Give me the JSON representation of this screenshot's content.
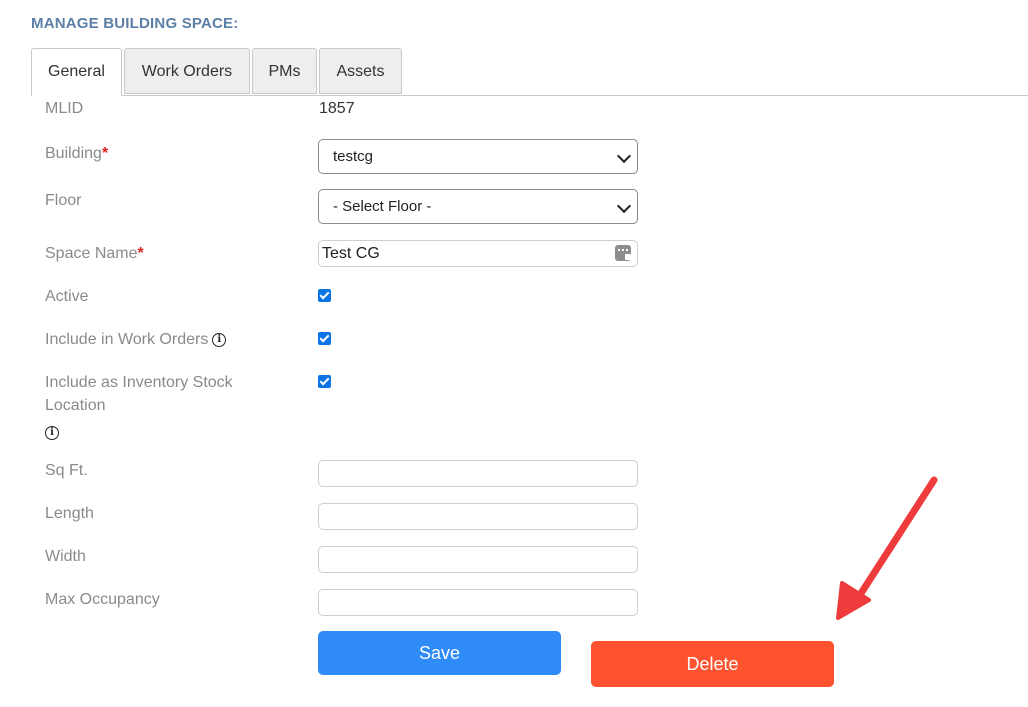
{
  "page": {
    "title": "MANAGE BUILDING SPACE:"
  },
  "tabs": [
    {
      "label": "General",
      "active": true
    },
    {
      "label": "Work Orders",
      "active": false
    },
    {
      "label": "PMs",
      "active": false
    },
    {
      "label": "Assets",
      "active": false
    }
  ],
  "form": {
    "mlid": {
      "label": "MLID",
      "value": "1857"
    },
    "building": {
      "label": "Building",
      "required_mark": "*",
      "value": "testcg"
    },
    "floor": {
      "label": "Floor",
      "value": "- Select Floor -"
    },
    "space_name": {
      "label": "Space Name",
      "required_mark": "*",
      "value": "Test CG"
    },
    "active": {
      "label": "Active",
      "checked": true
    },
    "include_work_orders": {
      "label": "Include in Work Orders",
      "checked": true,
      "info_glyph": "i"
    },
    "include_inventory": {
      "label_line1": "Include as Inventory Stock",
      "label_line2": "Location",
      "checked": true,
      "info_glyph": "i"
    },
    "sq_ft": {
      "label": "Sq Ft.",
      "value": ""
    },
    "length": {
      "label": "Length",
      "value": ""
    },
    "width": {
      "label": "Width",
      "value": ""
    },
    "max_occupancy": {
      "label": "Max Occupancy",
      "value": ""
    }
  },
  "buttons": {
    "save_label": "Save",
    "delete_label": "Delete"
  },
  "colors": {
    "title": "#5b7fa6",
    "save": "#2e8bf7",
    "delete": "#ff5330",
    "annotation_arrow": "#ee3b3b",
    "checkbox": "#0b74e5"
  }
}
